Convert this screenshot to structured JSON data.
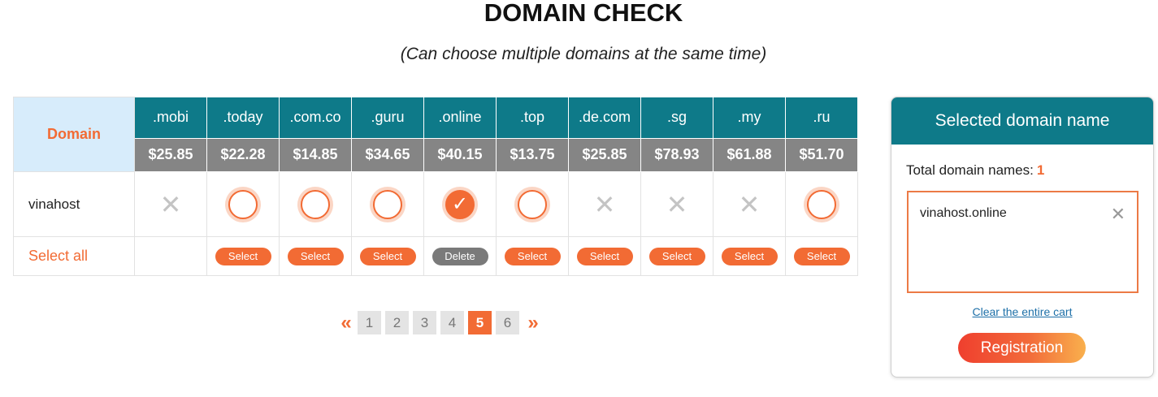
{
  "title": "DOMAIN CHECK",
  "subtitle": "(Can choose multiple domains at the same time)",
  "table": {
    "domain_header": "Domain",
    "name": "vinahost",
    "select_all": "Select all",
    "tlds": [
      {
        "name": ".mobi",
        "price": "$25.85",
        "status": "unavailable",
        "action": ""
      },
      {
        "name": ".today",
        "price": "$22.28",
        "status": "available",
        "action": "Select"
      },
      {
        "name": ".com.co",
        "price": "$14.85",
        "status": "available",
        "action": "Select"
      },
      {
        "name": ".guru",
        "price": "$34.65",
        "status": "available",
        "action": "Select"
      },
      {
        "name": ".online",
        "price": "$40.15",
        "status": "selected",
        "action": "Delete"
      },
      {
        "name": ".top",
        "price": "$13.75",
        "status": "available",
        "action": "Select"
      },
      {
        "name": ".de.com",
        "price": "$25.85",
        "status": "unavailable",
        "action": "Select"
      },
      {
        "name": ".sg",
        "price": "$78.93",
        "status": "unavailable",
        "action": "Select"
      },
      {
        "name": ".my",
        "price": "$61.88",
        "status": "unavailable",
        "action": "Select"
      },
      {
        "name": ".ru",
        "price": "$51.70",
        "status": "available",
        "action": "Select"
      }
    ]
  },
  "pagination": {
    "prev": "«",
    "next": "»",
    "pages": [
      "1",
      "2",
      "3",
      "4",
      "5",
      "6"
    ],
    "current": "5"
  },
  "cart": {
    "header": "Selected domain name",
    "total_label": "Total domain names:",
    "total_count": "1",
    "items": [
      "vinahost.online"
    ],
    "remove_glyph": "✕",
    "clear_label": "Clear the entire cart",
    "register_label": "Registration"
  },
  "colors": {
    "accent": "#f26b34",
    "header_teal": "#0e7a89",
    "price_gray": "#858585",
    "domain_header_bg": "#d7ecfb"
  },
  "icons": {
    "unavailable": "x-mark-icon",
    "available": "radio-circle-icon",
    "selected": "check-circle-icon"
  }
}
